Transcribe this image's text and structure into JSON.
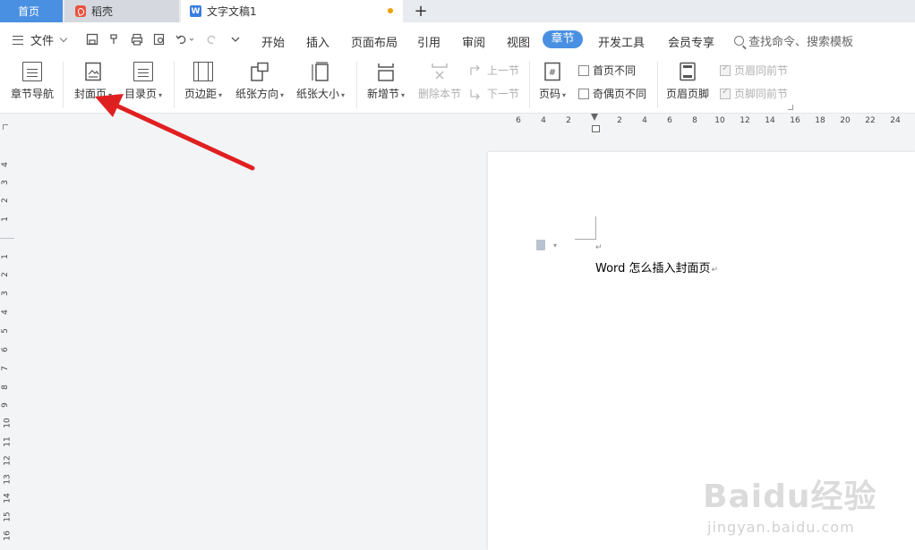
{
  "tabs": [
    {
      "label": "首页"
    },
    {
      "label": "稻壳"
    },
    {
      "label": "文字文稿1"
    }
  ],
  "new_tab_glyph": "+",
  "menu": {
    "file_label": "文件",
    "items": [
      "开始",
      "插入",
      "页面布局",
      "引用",
      "审阅",
      "视图",
      "章节",
      "开发工具",
      "会员专享"
    ],
    "active": "章节",
    "search_placeholder": "查找命令、搜索模板"
  },
  "ribbon": {
    "chapter_nav": "章节导航",
    "cover_page": "封面页",
    "toc_page": "目录页",
    "margins": "页边距",
    "orientation": "纸张方向",
    "paper_size": "纸张大小",
    "new_section": "新增节",
    "delete_section": "删除本节",
    "prev_section": "上一节",
    "next_section": "下一节",
    "page_number": "页码",
    "different_first_page": "首页不同",
    "different_odd_even": "奇偶页不同",
    "header_footer": "页眉页脚",
    "header_same_as_prev": "页眉同前节",
    "footer_same_as_prev": "页脚同前节"
  },
  "ruler": {
    "horizontal": [
      "6",
      "4",
      "2",
      "2",
      "4",
      "6",
      "8",
      "10",
      "12",
      "14",
      "16",
      "18",
      "20",
      "22",
      "24"
    ],
    "vertical": [
      "4",
      "3",
      "2",
      "1",
      "1",
      "2",
      "3",
      "4",
      "5",
      "6",
      "7",
      "8",
      "9",
      "10",
      "11",
      "12",
      "13",
      "14",
      "15",
      "16"
    ]
  },
  "document": {
    "text": "Word 怎么插入封面页"
  },
  "watermark": {
    "brand": "Baidu经验",
    "url": "jingyan.baidu.com"
  },
  "colors": {
    "accent": "#4a90e2",
    "annotation_arrow": "#e02020"
  }
}
